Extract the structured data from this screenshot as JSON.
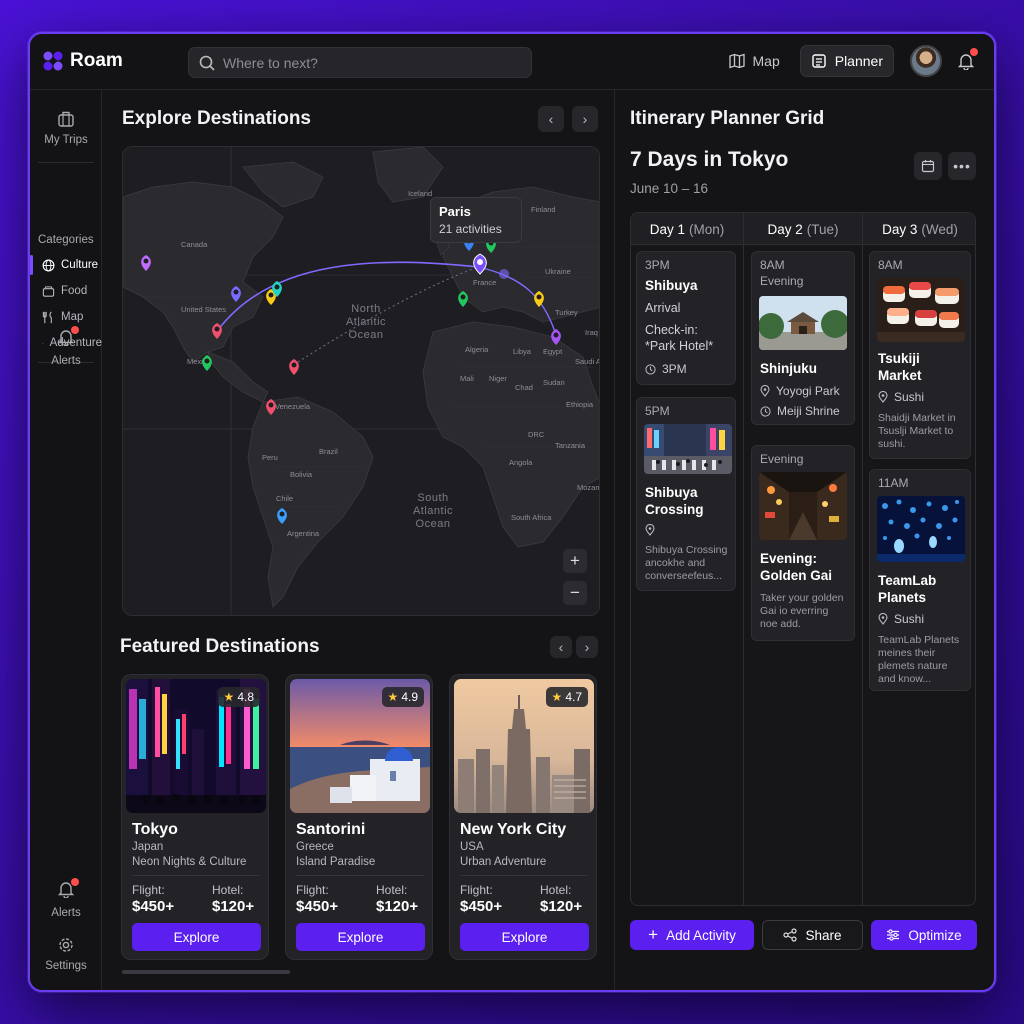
{
  "app": {
    "name": "Roam"
  },
  "search": {
    "placeholder": "Where to next?"
  },
  "topnav": {
    "map_label": "Map",
    "planner_label": "Planner"
  },
  "sidebar": {
    "my_trips": "My Trips",
    "categories_title": "Categories",
    "categories": [
      "Culture",
      "Food",
      "Map",
      "Adventure"
    ],
    "alerts_top": "Alerts",
    "alerts_bottom": "Alerts",
    "settings": "Settings"
  },
  "explore": {
    "title": "Explore Destinations",
    "tooltip": {
      "city": "Paris",
      "activities": "21 activities"
    },
    "map_labels": {
      "iceland": "Iceland",
      "finland": "Finland",
      "canada": "Canada",
      "france": "France",
      "ukraine": "Ukraine",
      "us": "United States",
      "north_atlantic": [
        "North",
        "Atlantic",
        "Ocean"
      ],
      "turkey": "Turkey",
      "iraq": "Iraq",
      "algeria": "Algeria",
      "libya": "Libya",
      "egypt": "Egypt",
      "saudi": "Saudi A",
      "mexico": "Mexico",
      "mali": "Mali",
      "niger": "Niger",
      "chad": "Chad",
      "sudan": "Sudan",
      "venezuela": "Venezuela",
      "ethiopia": "Ethiopia",
      "brazil": "Brazil",
      "drc": "DRC",
      "peru": "Peru",
      "tanzania": "Tanzania",
      "bolivia": "Bolivia",
      "angola": "Angola",
      "chile": "Chile",
      "south_atlantic": [
        "South",
        "Atlantic",
        "Ocean"
      ],
      "mozambique": "Mozamb",
      "argentina": "Argentina",
      "south_africa": "South Africa"
    }
  },
  "featured": {
    "title": "Featured Destinations",
    "cards": [
      {
        "name": "Tokyo",
        "country": "Japan",
        "tag": "Neon Nights & Culture",
        "rating": "4.8",
        "flight_label": "Flight:",
        "flight": "$450+",
        "hotel_label": "Hotel:",
        "hotel": "$120+",
        "cta": "Explore"
      },
      {
        "name": "Santorini",
        "country": "Greece",
        "tag": "Island Paradise",
        "rating": "4.9",
        "flight_label": "Flight:",
        "flight": "$450+",
        "hotel_label": "Hotel:",
        "hotel": "$120+",
        "cta": "Explore"
      },
      {
        "name": "New York City",
        "country": "USA",
        "tag": "Urban Adventure",
        "rating": "4.7",
        "flight_label": "Flight:",
        "flight": "$450+",
        "hotel_label": "Hotel:",
        "hotel": "$120+",
        "cta": "Explore"
      }
    ]
  },
  "planner": {
    "section_title": "Itinerary Planner Grid",
    "trip_title": "7 Days in Tokyo",
    "dates": "June 10 – 16",
    "days": [
      {
        "label": "Day 1",
        "weekday": "(Mon)"
      },
      {
        "label": "Day 2",
        "weekday": "(Tue)"
      },
      {
        "label": "Day 3",
        "weekday": "(Wed)"
      }
    ],
    "activities": {
      "d1a": {
        "time": "3PM",
        "title": "Shibuya",
        "line1": "Arrival",
        "line2": "Check-in:",
        "line3": "*Park Hotel*",
        "meta": "3PM"
      },
      "d1b": {
        "time": "5PM",
        "title1": "Shibuya",
        "title2": "Crossing",
        "desc": "Shibuya Crossing ancokhe and converseefeus..."
      },
      "d2a": {
        "time": "8AM",
        "subtime": "Evening",
        "title": "Shinjuku",
        "meta1": "Yoyogi Park",
        "meta2": "Meiji Shrine"
      },
      "d2b": {
        "time": "Evening",
        "title1": "Evening:",
        "title2": "Golden Gai",
        "desc": "Taker your golden Gai io everring noe add."
      },
      "d3a": {
        "time": "8AM",
        "title1": "Tsukiji",
        "title2": "Market",
        "meta": "Sushi",
        "desc": "Shaidji Market in Tsuslji Market to sushi."
      },
      "d3b": {
        "time": "11AM",
        "title1": "TeamLab",
        "title2": "Planets",
        "meta": "Sushi",
        "desc": "TeamLab Planets meines their plemets nature and know..."
      }
    },
    "buttons": {
      "add": "Add Activity",
      "share": "Share",
      "optimize": "Optimize"
    }
  },
  "colors": {
    "accent": "#5b1ff0",
    "background": "#141416",
    "pin_purple": "#8b5cf6",
    "pin_red": "#f0506e",
    "pin_green": "#22c55e",
    "pin_yellow": "#facc15",
    "pin_blue": "#3b9eff"
  }
}
